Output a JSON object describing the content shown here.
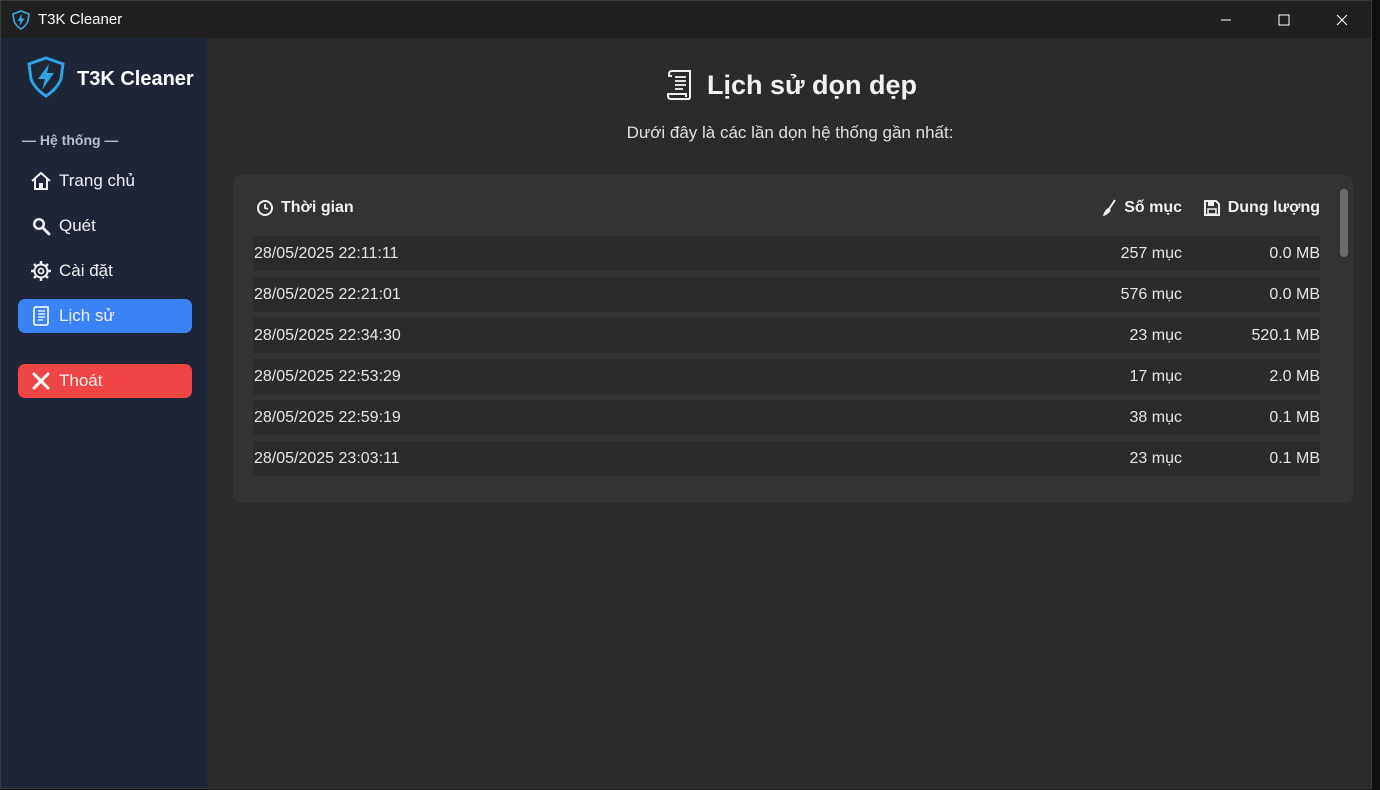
{
  "window": {
    "title": "T3K Cleaner"
  },
  "sidebar": {
    "brand": "T3K Cleaner",
    "section_label": "— Hệ thống —",
    "items": [
      {
        "label": "Trang chủ",
        "icon": "home-icon"
      },
      {
        "label": "Quét",
        "icon": "search-icon"
      },
      {
        "label": "Cài đặt",
        "icon": "gear-icon"
      },
      {
        "label": "Lịch sử",
        "icon": "scroll-icon",
        "active": true
      }
    ],
    "exit": {
      "label": "Thoát",
      "icon": "close-icon"
    }
  },
  "main": {
    "title": "Lịch sử dọn dẹp",
    "subtitle": "Dưới đây là các lần dọn hệ thống gần nhất:",
    "table": {
      "headers": {
        "time": "Thời gian",
        "count": "Số mục",
        "size": "Dung lượng"
      },
      "rows": [
        {
          "time": "28/05/2025 22:11:11",
          "count": "257 mục",
          "size": "0.0 MB"
        },
        {
          "time": "28/05/2025 22:21:01",
          "count": "576 mục",
          "size": "0.0 MB"
        },
        {
          "time": "28/05/2025 22:34:30",
          "count": "23 mục",
          "size": "520.1 MB"
        },
        {
          "time": "28/05/2025 22:53:29",
          "count": "17 mục",
          "size": "2.0 MB"
        },
        {
          "time": "28/05/2025 22:59:19",
          "count": "38 mục",
          "size": "0.1 MB"
        },
        {
          "time": "28/05/2025 23:03:11",
          "count": "23 mục",
          "size": "0.1 MB"
        }
      ]
    }
  },
  "colors": {
    "accent": "#3b82f6",
    "danger": "#ef4444",
    "sidebar_bg": "#1d2537",
    "content_bg": "#2b2b2b"
  }
}
